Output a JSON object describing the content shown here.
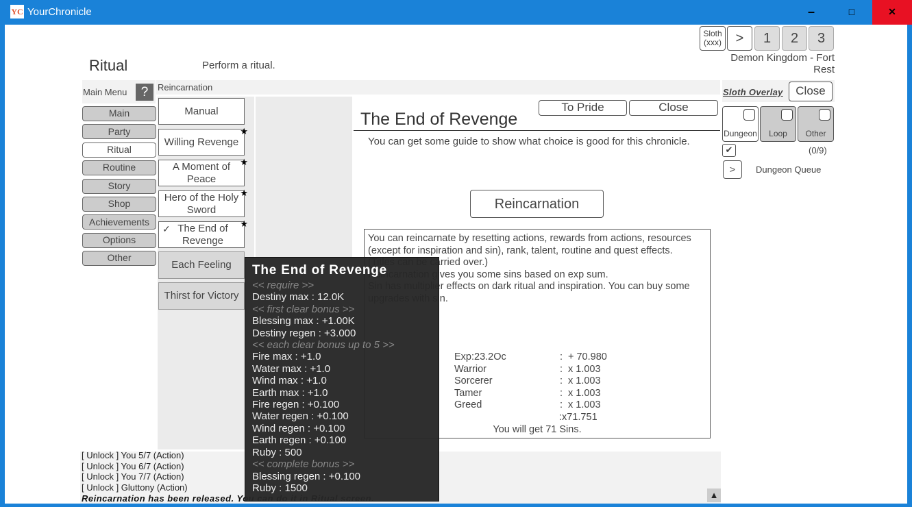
{
  "window": {
    "title": "YourChronicle",
    "logo": "YC",
    "minimize": "–",
    "maximize": "□",
    "close": "✕"
  },
  "header": {
    "title": "Ritual",
    "description": "Perform a ritual.",
    "location": "Demon Kingdom - Fort Rest"
  },
  "top_buttons": {
    "sloth": "Sloth (xxx)",
    "next": ">",
    "slots": [
      "1",
      "2",
      "3"
    ]
  },
  "main_menu": {
    "label": "Main Menu",
    "help": "?",
    "items": [
      "Main",
      "Party",
      "Ritual",
      "Routine",
      "Story",
      "Shop",
      "Achievements",
      "Options",
      "Other"
    ],
    "selected": "Ritual"
  },
  "section_label": "Reincarnation",
  "rituals": [
    {
      "label": "Manual",
      "star": false
    },
    {
      "label": "Willing Revenge",
      "star": true
    },
    {
      "label": "A Moment of Peace",
      "star": true
    },
    {
      "label": "Hero of the Holy Sword",
      "star": true
    },
    {
      "label": "The End of Revenge",
      "star": true,
      "checked": true
    },
    {
      "label": "Each Feeling",
      "star": false
    },
    {
      "label": "Thirst for Victory",
      "star": false
    }
  ],
  "panel": {
    "title": "The End of Revenge",
    "to_pride": "To Pride",
    "close": "Close",
    "guide": "You can get some guide to show what choice is good for this chronicle.",
    "action": "Reincarnation",
    "info": [
      "You can reincarnate by resetting actions, rewards from actions, resources (except for inspiration and sin), rank, talent, routine and quest effects.",
      "(Titles can be carried over.)",
      "Reincarnation gives you some sins based on exp sum.",
      "Sin has multiplier effects on dark ritual and inspiration. You can buy some upgrades with sin."
    ],
    "stats": [
      {
        "label": "Exp:23.2Oc",
        "sep": ":",
        "value": "+ 70.980"
      },
      {
        "label": "Warrior",
        "sep": ":",
        "value": "x 1.003"
      },
      {
        "label": "Sorcerer",
        "sep": ":",
        "value": "x 1.003"
      },
      {
        "label": "Tamer",
        "sep": ":",
        "value": "x 1.003"
      },
      {
        "label": "Greed",
        "sep": ":",
        "value": "x 1.003"
      },
      {
        "label": "",
        "sep": "",
        "value": ":x71.751"
      }
    ],
    "result": "You will get 71 Sins."
  },
  "tooltip": {
    "title": "The End of Revenge",
    "lines": [
      {
        "t": "<< require >>",
        "h": true
      },
      {
        "t": "Destiny max : 12.0K"
      },
      {
        "t": "<< first clear bonus >>",
        "h": true
      },
      {
        "t": "Blessing max : +1.00K"
      },
      {
        "t": "Destiny regen : +3.000"
      },
      {
        "t": "<< each clear bonus up to 5 >>",
        "h": true
      },
      {
        "t": "Fire max : +1.0"
      },
      {
        "t": "Water max : +1.0"
      },
      {
        "t": "Wind max : +1.0"
      },
      {
        "t": "Earth max : +1.0"
      },
      {
        "t": "Fire regen : +0.100"
      },
      {
        "t": "Water regen : +0.100"
      },
      {
        "t": "Wind regen : +0.100"
      },
      {
        "t": "Earth regen : +0.100"
      },
      {
        "t": "Ruby : 500"
      },
      {
        "t": "<< complete bonus >>",
        "h": true
      },
      {
        "t": "Blessing regen : +0.100"
      },
      {
        "t": "Ruby : 1500"
      }
    ]
  },
  "sloth": {
    "title": "Sloth Overlay",
    "close": "Close",
    "toggles": [
      {
        "label": "Dungeon",
        "active": true
      },
      {
        "label": "Loop",
        "active": false
      },
      {
        "label": "Other",
        "active": false
      }
    ],
    "count": "(0/9)",
    "queue_button": ">",
    "queue_label": "Dungeon Queue"
  },
  "log": {
    "lines": [
      "[ Unlock ] You 5/7 (Action)",
      "[ Unlock ] You 6/7 (Action)",
      "[ Unlock ] You 7/7 (Action)",
      "[ Unlock ] Gluttony (Action)"
    ],
    "notice": "Reincarnation has been released. You can do it in Ritual screen.",
    "scroll_up": "▲"
  }
}
